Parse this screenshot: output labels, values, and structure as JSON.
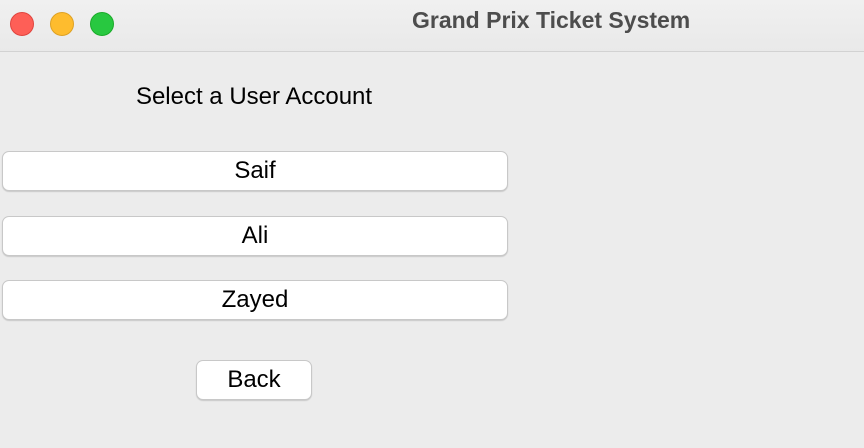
{
  "window": {
    "title": "Grand Prix Ticket System"
  },
  "main": {
    "heading": "Select a User Account",
    "users": [
      {
        "label": "Saif"
      },
      {
        "label": "Ali"
      },
      {
        "label": "Zayed"
      }
    ],
    "back_label": "Back"
  },
  "colors": {
    "background": "#ececec",
    "close": "#fe5f57",
    "minimize": "#febc2e",
    "zoom": "#28c840"
  }
}
